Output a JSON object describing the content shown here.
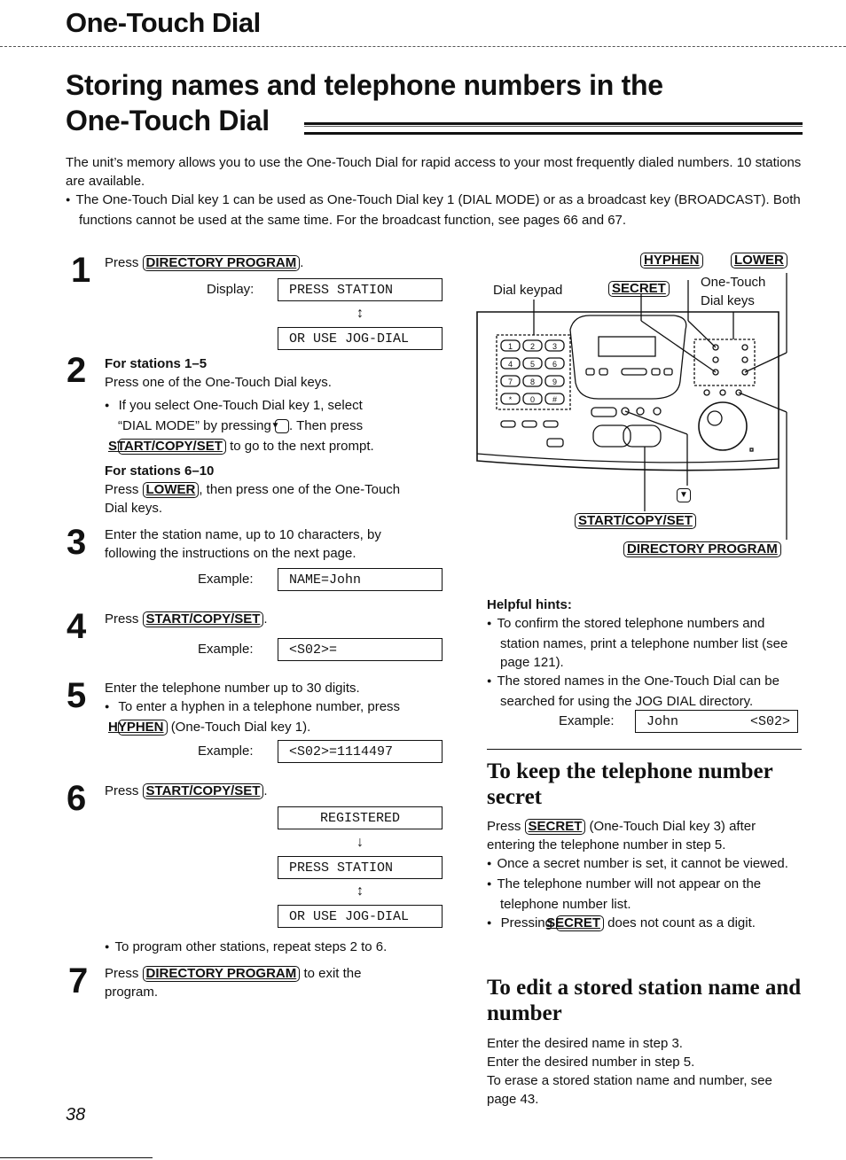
{
  "header": {
    "section_title": "One-Touch Dial",
    "page_title_line1": "Storing names and telephone numbers in the",
    "page_title_line2": "One-Touch Dial"
  },
  "intro": {
    "paragraph": "The unit’s memory allows you to use the One-Touch Dial for rapid access to your most frequently dialed numbers. 10 stations are available.",
    "bullet": "The One-Touch Dial key 1 can be used as One-Touch Dial key 1 (DIAL MODE) or as a broadcast key (BROADCAST). Both functions cannot be used at the same time. For the broadcast function, see pages 66 and 67."
  },
  "keys": {
    "directory_program": "DIRECTORY PROGRAM",
    "start_copy_set": "START/COPY/SET",
    "lower": "LOWER",
    "hyphen": "HYPHEN",
    "secret": "SECRET",
    "down_arrow": "▼"
  },
  "steps": {
    "s1": {
      "num": "1",
      "press": "Press",
      "after": ".",
      "display_label": "Display:",
      "lcd1": "PRESS STATION",
      "lcd2": "OR USE JOG-DIAL",
      "arrow": "↕"
    },
    "s2": {
      "num": "2",
      "head1": "For stations 1–5",
      "text1": "Press one of the One-Touch Dial keys.",
      "bullet_a": "If you select One-Touch Dial key 1, select",
      "bullet_b": "“DIAL MODE” by pressing",
      "bullet_c": ". Then press",
      "bullet_d": "to go to the next prompt.",
      "head2": "For stations 6–10",
      "text2a": "Press",
      "text2b": ", then press one of the One-Touch",
      "text2c": "Dial keys."
    },
    "s3": {
      "num": "3",
      "text": "Enter the station name, up to 10 characters, by following the instructions on the next page.",
      "example_label": "Example:",
      "lcd": "NAME=John"
    },
    "s4": {
      "num": "4",
      "press": "Press",
      "after": ".",
      "example_label": "Example:",
      "lcd": "<S02>="
    },
    "s5": {
      "num": "5",
      "text": "Enter the telephone number up to 30 digits.",
      "bullet_a": "To enter a hyphen in a telephone number, press",
      "bullet_b": "(One-Touch Dial key 1).",
      "example_label": "Example:",
      "lcd": "<S02>=1114497"
    },
    "s6": {
      "num": "6",
      "press": "Press",
      "after": ".",
      "lcd1": "REGISTERED",
      "arrow1": "↓",
      "lcd2": "PRESS STATION",
      "arrow2": "↕",
      "lcd3": "OR USE JOG-DIAL",
      "bullet": "To program other stations, repeat steps 2 to 6."
    },
    "s7": {
      "num": "7",
      "press": "Press",
      "after": "to exit the",
      "after2": "program."
    }
  },
  "diagram": {
    "label_dial_keypad": "Dial keypad",
    "label_one_touch": "One-Touch",
    "label_dial_keys": "Dial keys",
    "keypad": [
      "1",
      "2",
      "3",
      "4",
      "5",
      "6",
      "7",
      "8",
      "9",
      "*",
      "0",
      "#"
    ]
  },
  "hints": {
    "title": "Helpful hints:",
    "items": [
      "To confirm the stored telephone numbers and station names, print a telephone number list (see page 121).",
      "The stored names in the One-Touch Dial can be searched for using the JOG DIAL directory."
    ],
    "example_label": "Example:",
    "lcd_name": "John",
    "lcd_code": "<S02>"
  },
  "secret_section": {
    "title": "To keep the telephone number secret",
    "text_a": "Press",
    "text_b": "(One-Touch Dial key 3) after entering the telephone number in step 5.",
    "bullets": [
      "Once a secret number is set, it cannot be viewed.",
      "The telephone number will not appear on the telephone number list."
    ],
    "bullet3_a": "Pressing",
    "bullet3_b": "does not count as a digit."
  },
  "edit_section": {
    "title": "To edit a stored station name and number",
    "lines": [
      "Enter the desired name in step 3.",
      "Enter the desired number in step 5.",
      "To erase a stored station name and number, see page 43."
    ]
  },
  "footer": {
    "page_number": "38"
  }
}
